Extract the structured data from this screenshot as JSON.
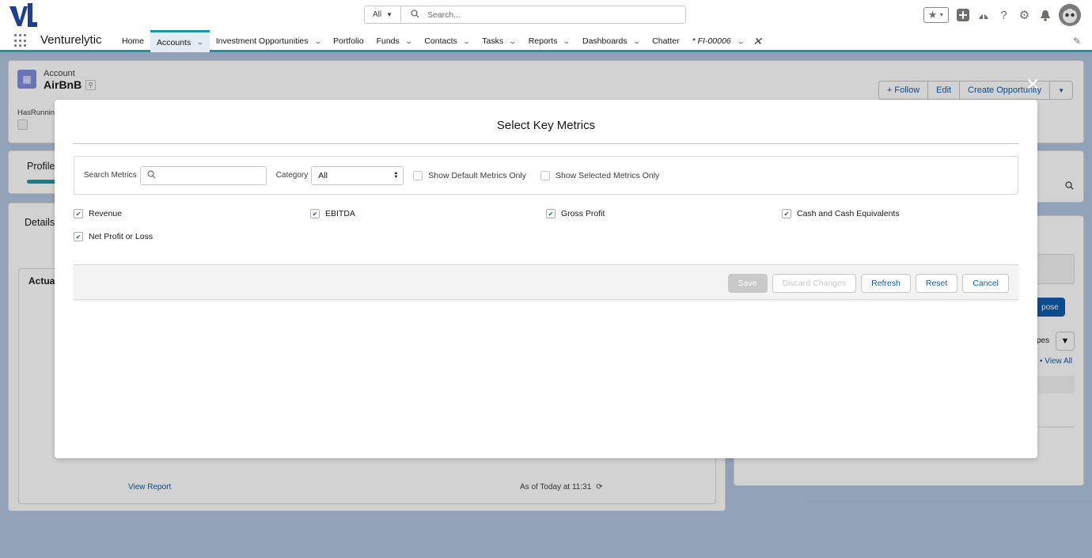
{
  "header": {
    "search_scope": "All",
    "search_placeholder": "Search...",
    "colors": {
      "teal_accent": "#1b96a6",
      "link_blue": "#0b5cab",
      "logo_blue": "#1c3f94"
    }
  },
  "nav": {
    "app_name": "Venturelytic",
    "items": [
      {
        "label": "Home",
        "dropdown": false
      },
      {
        "label": "Accounts",
        "dropdown": true,
        "active": true
      },
      {
        "label": "Investment Opportunities",
        "dropdown": true
      },
      {
        "label": "Portfolio",
        "dropdown": false
      },
      {
        "label": "Funds",
        "dropdown": true
      },
      {
        "label": "Contacts",
        "dropdown": true
      },
      {
        "label": "Tasks",
        "dropdown": true
      },
      {
        "label": "Reports",
        "dropdown": true
      },
      {
        "label": "Dashboards",
        "dropdown": true
      },
      {
        "label": "Chatter",
        "dropdown": false
      }
    ],
    "open_tab": "* FI-00006"
  },
  "record": {
    "type": "Account",
    "name": "AirBnB",
    "actions": [
      "+ Follow",
      "Edit",
      "Create Opportunity"
    ],
    "field_label": "HasRunning"
  },
  "background": {
    "profile_tab": "Profile",
    "details_tab": "Details",
    "actuals_title": "Actua",
    "view_report": "View Report",
    "as_of": "As of Today at 11:31",
    "compose": "pose",
    "types": "pes",
    "view_all": "• View All"
  },
  "modal": {
    "title": "Select Key Metrics",
    "search_label": "Search Metrics",
    "search_value": "",
    "category_label": "Category",
    "category_value": "All",
    "show_default": "Show Default Metrics Only",
    "show_selected": "Show Selected Metrics Only",
    "metrics": [
      {
        "label": "Revenue",
        "checked": true
      },
      {
        "label": "EBITDA",
        "checked": true
      },
      {
        "label": "Gross Profit",
        "checked": true
      },
      {
        "label": "Cash and Cash Equivalents",
        "checked": true
      },
      {
        "label": "Net Profit or Loss",
        "checked": true
      }
    ],
    "buttons": {
      "save": "Save",
      "discard": "Discard Changes",
      "refresh": "Refresh",
      "reset": "Reset",
      "cancel": "Cancel"
    }
  }
}
